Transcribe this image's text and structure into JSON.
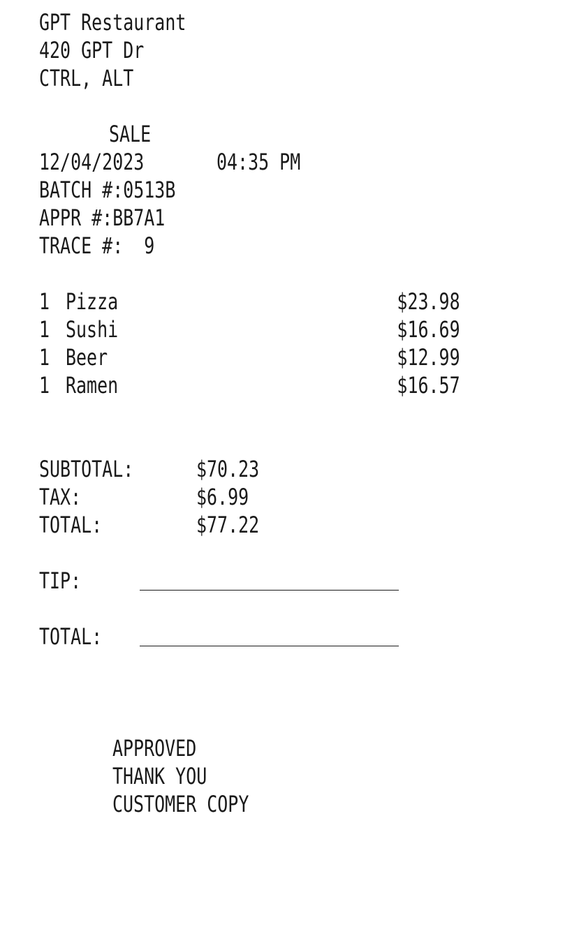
{
  "header": {
    "name": "GPT Restaurant",
    "address": "420 GPT Dr",
    "city": "CTRL, ALT"
  },
  "transaction": {
    "type": "SALE",
    "date": "12/04/2023",
    "time": "04:35 PM",
    "batch_label": "BATCH #:",
    "batch": "0513B",
    "appr_label": "APPR #:",
    "appr": "BB7A1",
    "trace_label": "TRACE #:",
    "trace": "9"
  },
  "items": [
    {
      "qty": "1",
      "name": "Pizza",
      "price": "$23.98"
    },
    {
      "qty": "1",
      "name": "Sushi",
      "price": "$16.69"
    },
    {
      "qty": "1",
      "name": "Beer",
      "price": "$12.99"
    },
    {
      "qty": "1",
      "name": "Ramen",
      "price": "$16.57"
    }
  ],
  "totals": {
    "subtotal_label": "SUBTOTAL:",
    "subtotal": "$70.23",
    "tax_label": "TAX:",
    "tax": "$6.99",
    "total_label": "TOTAL:",
    "total": "$77.22"
  },
  "signature": {
    "tip_label": "TIP:",
    "total_label": "TOTAL:"
  },
  "footer": {
    "approved": "APPROVED",
    "thanks": "THANK YOU",
    "copy": "CUSTOMER COPY"
  }
}
